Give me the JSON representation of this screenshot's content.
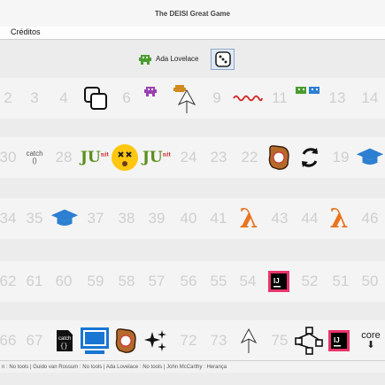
{
  "window": {
    "title": "The DEISI Great Game"
  },
  "menu": {
    "creditos": "Créditos"
  },
  "player": {
    "current_name": "Ada Lovelace"
  },
  "rows": [
    {
      "cells": [
        "2",
        "3",
        "4",
        "",
        "6",
        "",
        "",
        "9",
        "",
        "11",
        "",
        "13",
        "14"
      ]
    },
    {
      "cells": [
        "30",
        "",
        "28",
        "",
        "",
        "",
        "24",
        "23",
        "22",
        "",
        "",
        "19",
        ""
      ]
    },
    {
      "cells": [
        "34",
        "35",
        "",
        "37",
        "38",
        "39",
        "40",
        "41",
        "",
        "43",
        "44",
        "",
        "46"
      ]
    },
    {
      "cells": [
        "62",
        "61",
        "60",
        "59",
        "58",
        "57",
        "56",
        "55",
        "54",
        "",
        "52",
        "51",
        "50"
      ]
    },
    {
      "cells": [
        "66",
        "67",
        "",
        "",
        "",
        "",
        "72",
        "73",
        "",
        "75",
        "",
        "",
        ""
      ]
    }
  ],
  "labels": {
    "catch": "catch",
    "catch_parens": "()",
    "core": "core",
    "ij": "IJ"
  },
  "status_bar": {
    "text": "n : No tools | Guido van Rossum : No tools | Ada Lovelace : No tools | John McCarthy : Herança"
  },
  "colors": {
    "lambda": "#e8741f",
    "junit": "#5a8f1d",
    "sprite_green": "#4a9d2f",
    "sprite_purple": "#9b3fb3",
    "sprite_orange": "#d18a1d"
  }
}
